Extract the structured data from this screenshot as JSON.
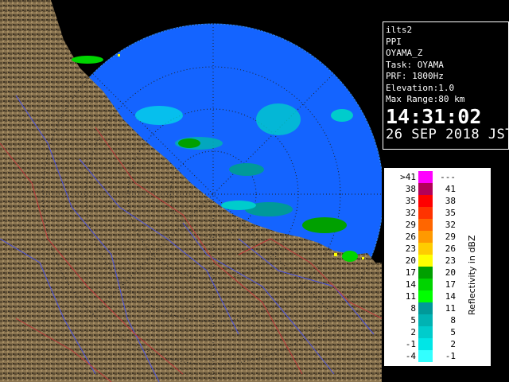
{
  "info": {
    "lines": [
      "ilts2",
      "PPI",
      "OYAMA_Z",
      "Task: OYAMA",
      "PRF: 1800Hz",
      "Elevation:1.0",
      "Max Range:80 km"
    ],
    "time": "14:31:02",
    "date": "26 SEP 2018 JST"
  },
  "legend": {
    "unit": "Reflectivity in dBZ",
    "rows": [
      {
        "lo": ">41",
        "hi": "---",
        "color": "#ff00ff"
      },
      {
        "lo": "38",
        "hi": "41",
        "color": "#b30059"
      },
      {
        "lo": "35",
        "hi": "38",
        "color": "#ff0000"
      },
      {
        "lo": "32",
        "hi": "35",
        "color": "#ff3300"
      },
      {
        "lo": "29",
        "hi": "32",
        "color": "#ff6600"
      },
      {
        "lo": "26",
        "hi": "29",
        "color": "#ff9900"
      },
      {
        "lo": "23",
        "hi": "26",
        "color": "#ffcc00"
      },
      {
        "lo": "20",
        "hi": "23",
        "color": "#ffff00"
      },
      {
        "lo": "17",
        "hi": "20",
        "color": "#00a000"
      },
      {
        "lo": "14",
        "hi": "17",
        "color": "#00d400"
      },
      {
        "lo": "11",
        "hi": "14",
        "color": "#00ff00"
      },
      {
        "lo": "8",
        "hi": "11",
        "color": "#009999"
      },
      {
        "lo": "5",
        "hi": "8",
        "color": "#00b3b3"
      },
      {
        "lo": "2",
        "hi": "5",
        "color": "#00cccc"
      },
      {
        "lo": "-1",
        "hi": "2",
        "color": "#00e6e6"
      },
      {
        "lo": "-4",
        "hi": "-1",
        "color": "#33ffff"
      }
    ]
  },
  "colors": {
    "sea": "#1464ff",
    "sea_far": "#1b7bff",
    "land": "#8a7450",
    "land_dark": "#3a3020",
    "rivers": "#4c54e0",
    "boundaries": "#c0383a"
  }
}
